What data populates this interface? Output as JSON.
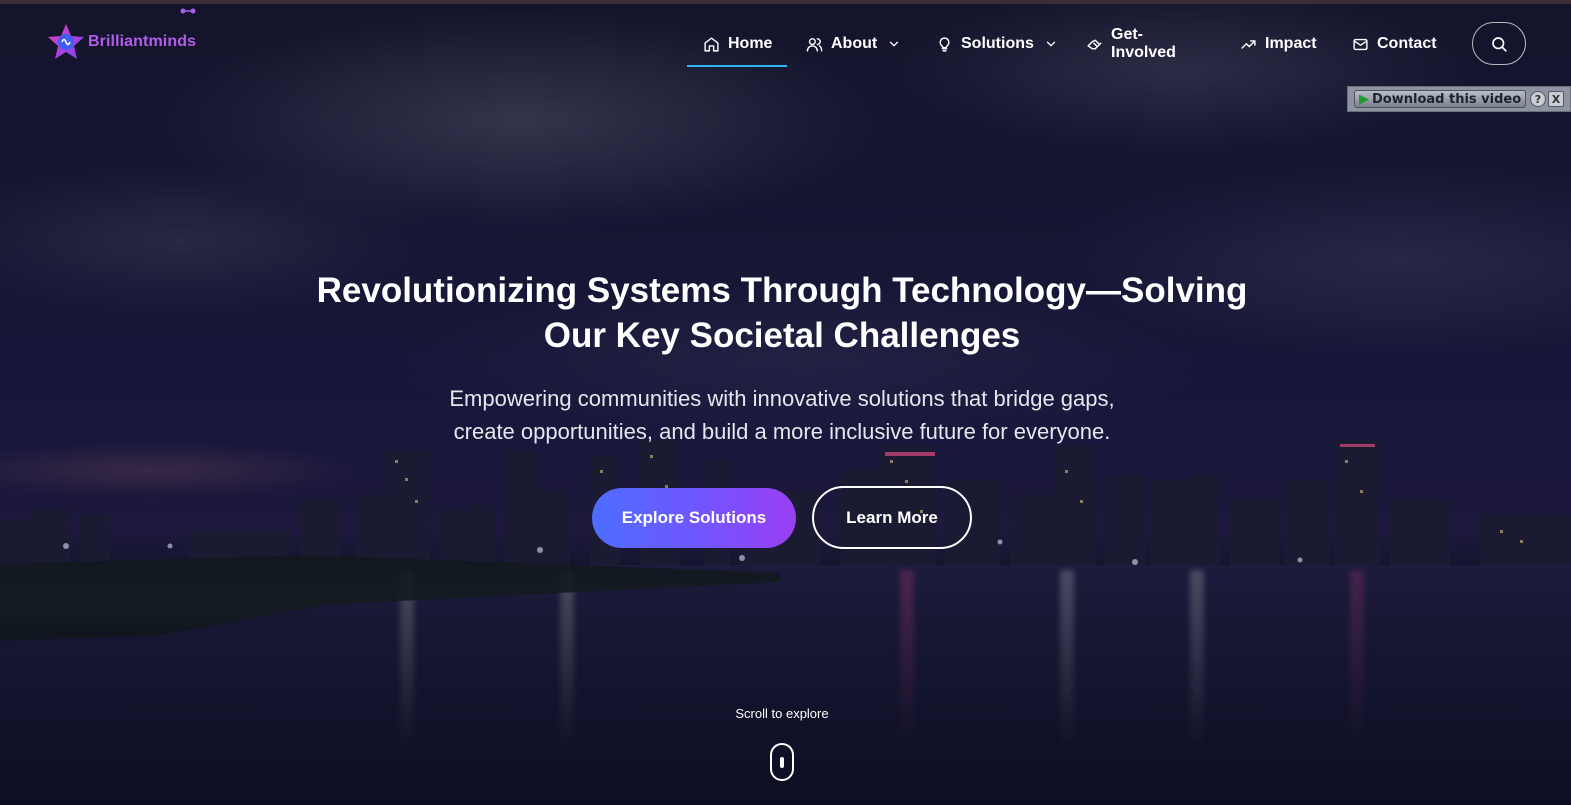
{
  "brand": {
    "name": "Brilliantmind",
    "name_accent": "s",
    "logo_icon": "star-brain-icon",
    "color": "#b15de9"
  },
  "nav": {
    "items": [
      {
        "label": "Home",
        "icon": "home-icon",
        "active": true
      },
      {
        "label": "About",
        "icon": "users-icon",
        "dropdown": true
      },
      {
        "label": "Solutions",
        "icon": "lightbulb-icon",
        "dropdown": true
      },
      {
        "label": "Get-Involved",
        "icon": "handshake-icon"
      },
      {
        "label": "Impact",
        "icon": "trending-up-icon"
      },
      {
        "label": "Contact",
        "icon": "mail-icon"
      }
    ],
    "active_underline_color": "#2fb3f5",
    "search_icon": "search-icon"
  },
  "plugin": {
    "download_label": "Download this video",
    "help_label": "?",
    "close_label": "X"
  },
  "hero": {
    "title_line1": "Revolutionizing Systems Through Technology—Solving",
    "title_line2": "Our Key Societal Challenges",
    "subtitle_line1": "Empowering communities with innovative solutions that bridge gaps,",
    "subtitle_line2": "create opportunities, and build a more inclusive future for everyone.",
    "primary_button": "Explore Solutions",
    "secondary_button": "Learn More",
    "scroll_hint": "Scroll to explore"
  },
  "colors": {
    "primary_gradient_start": "#4d6dff",
    "primary_gradient_end": "#9a3ff3"
  }
}
